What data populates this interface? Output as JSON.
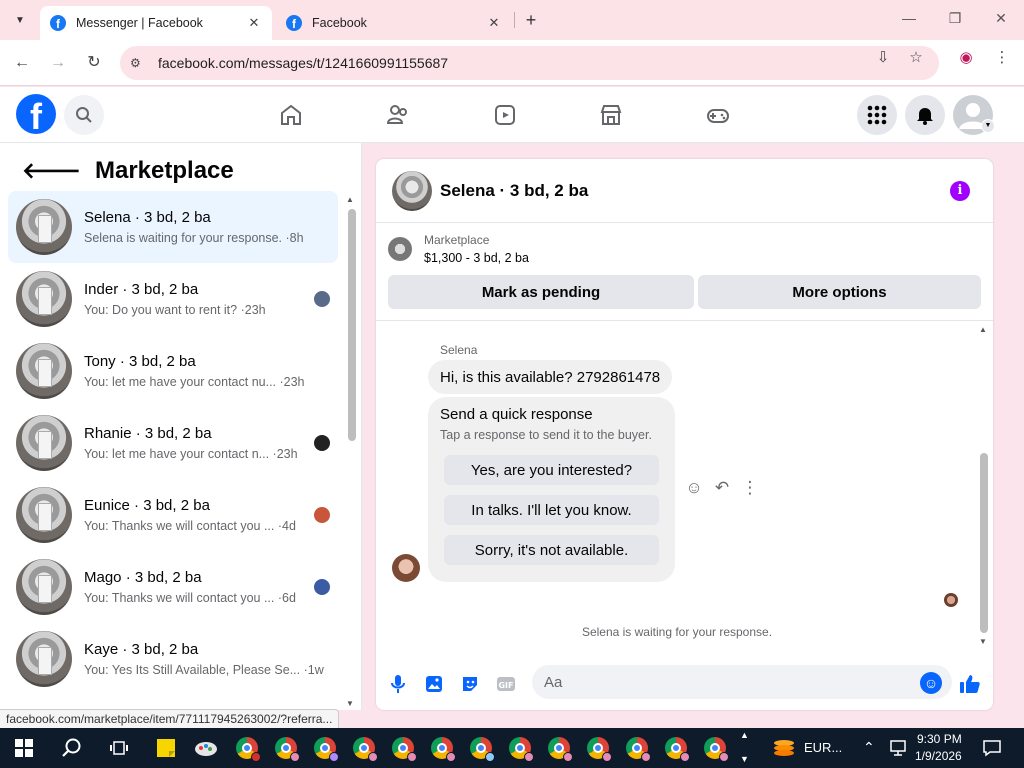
{
  "browser": {
    "tabs": [
      {
        "title": "Messenger | Facebook",
        "close": "✕"
      },
      {
        "title": "Facebook",
        "close": "✕"
      }
    ],
    "new_tab": "+",
    "url": "facebook.com/messages/t/1241660991155687",
    "status_url": "facebook.com/marketplace/item/771117945263002/?referra..."
  },
  "fb": {
    "logo": "f",
    "colors": {
      "brand": "#0866ff",
      "info": "#a100ff"
    }
  },
  "left_panel": {
    "title": "Marketplace",
    "conversations": [
      {
        "name": "Selena · 3 bd, 2 ba",
        "preview": "Selena is waiting for your response. ·8h",
        "active": true
      },
      {
        "name": "Inder · 3 bd, 2 ba",
        "preview": "You: Do you want to rent it? ·23h"
      },
      {
        "name": "Tony · 3 bd, 2 ba",
        "preview": "You: let me have your contact nu... ·23h"
      },
      {
        "name": "Rhanie · 3 bd, 2 ba",
        "preview": "You: let me have your contact n... ·23h"
      },
      {
        "name": "Eunice · 3 bd, 2 ba",
        "preview": "You: Thanks we will contact you ... ·4d"
      },
      {
        "name": "Mago · 3 bd, 2 ba",
        "preview": "You: Thanks we will contact you ... ·6d"
      },
      {
        "name": "Kaye · 3 bd, 2 ba",
        "preview": "You: Yes Its Still Available, Please Se... ·1w"
      }
    ]
  },
  "chat": {
    "title": "Selena · 3 bd, 2 ba",
    "info_icon": "i",
    "listing": {
      "source": "Marketplace",
      "price_line": "$1,300 - 3 bd, 2 ba"
    },
    "buttons": {
      "pending": "Mark as pending",
      "more": "More options"
    },
    "sender": "Selena",
    "message": "Hi, is this available? 2792861478",
    "quick_response": {
      "title": "Send a quick response",
      "subtitle": "Tap a response to send it to the buyer.",
      "options": [
        "Yes, are you interested?",
        "In talks. I'll let you know.",
        "Sorry, it's not available."
      ]
    },
    "status": "Selena is waiting for your response.",
    "composer_placeholder": "Aa"
  },
  "taskbar": {
    "currency": "EUR...",
    "time": "9:30 PM",
    "date": "1/9/2026"
  }
}
